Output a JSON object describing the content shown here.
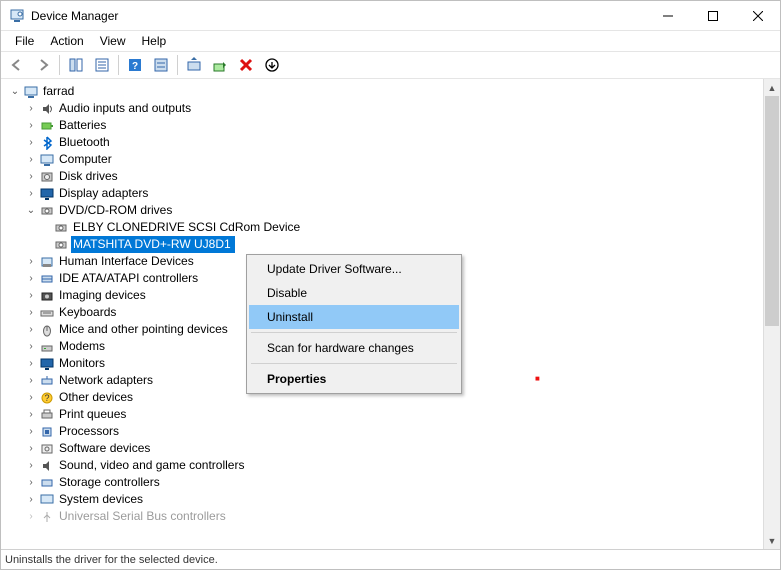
{
  "titlebar": {
    "title": "Device Manager"
  },
  "menubar": {
    "file": "File",
    "action": "Action",
    "view": "View",
    "help": "Help"
  },
  "tree": {
    "root": "farrad",
    "items": [
      {
        "label": "Audio inputs and outputs",
        "expanded": false
      },
      {
        "label": "Batteries",
        "expanded": false
      },
      {
        "label": "Bluetooth",
        "expanded": false
      },
      {
        "label": "Computer",
        "expanded": false
      },
      {
        "label": "Disk drives",
        "expanded": false
      },
      {
        "label": "Display adapters",
        "expanded": false
      },
      {
        "label": "DVD/CD-ROM drives",
        "expanded": true,
        "children": [
          {
            "label": "ELBY CLONEDRIVE SCSI CdRom Device"
          },
          {
            "label": "MATSHITA DVD+-RW UJ8D1",
            "selected": true
          }
        ]
      },
      {
        "label": "Human Interface Devices",
        "expanded": false
      },
      {
        "label": "IDE ATA/ATAPI controllers",
        "expanded": false
      },
      {
        "label": "Imaging devices",
        "expanded": false
      },
      {
        "label": "Keyboards",
        "expanded": false
      },
      {
        "label": "Mice and other pointing devices",
        "expanded": false
      },
      {
        "label": "Modems",
        "expanded": false
      },
      {
        "label": "Monitors",
        "expanded": false
      },
      {
        "label": "Network adapters",
        "expanded": false
      },
      {
        "label": "Other devices",
        "expanded": false
      },
      {
        "label": "Print queues",
        "expanded": false
      },
      {
        "label": "Processors",
        "expanded": false
      },
      {
        "label": "Software devices",
        "expanded": false
      },
      {
        "label": "Sound, video and game controllers",
        "expanded": false
      },
      {
        "label": "Storage controllers",
        "expanded": false
      },
      {
        "label": "System devices",
        "expanded": false
      },
      {
        "label": "Universal Serial Bus controllers",
        "expanded": false
      }
    ]
  },
  "context_menu": {
    "update": "Update Driver Software...",
    "disable": "Disable",
    "uninstall": "Uninstall",
    "scan": "Scan for hardware changes",
    "properties": "Properties"
  },
  "statusbar": {
    "text": "Uninstalls the driver for the selected device."
  }
}
